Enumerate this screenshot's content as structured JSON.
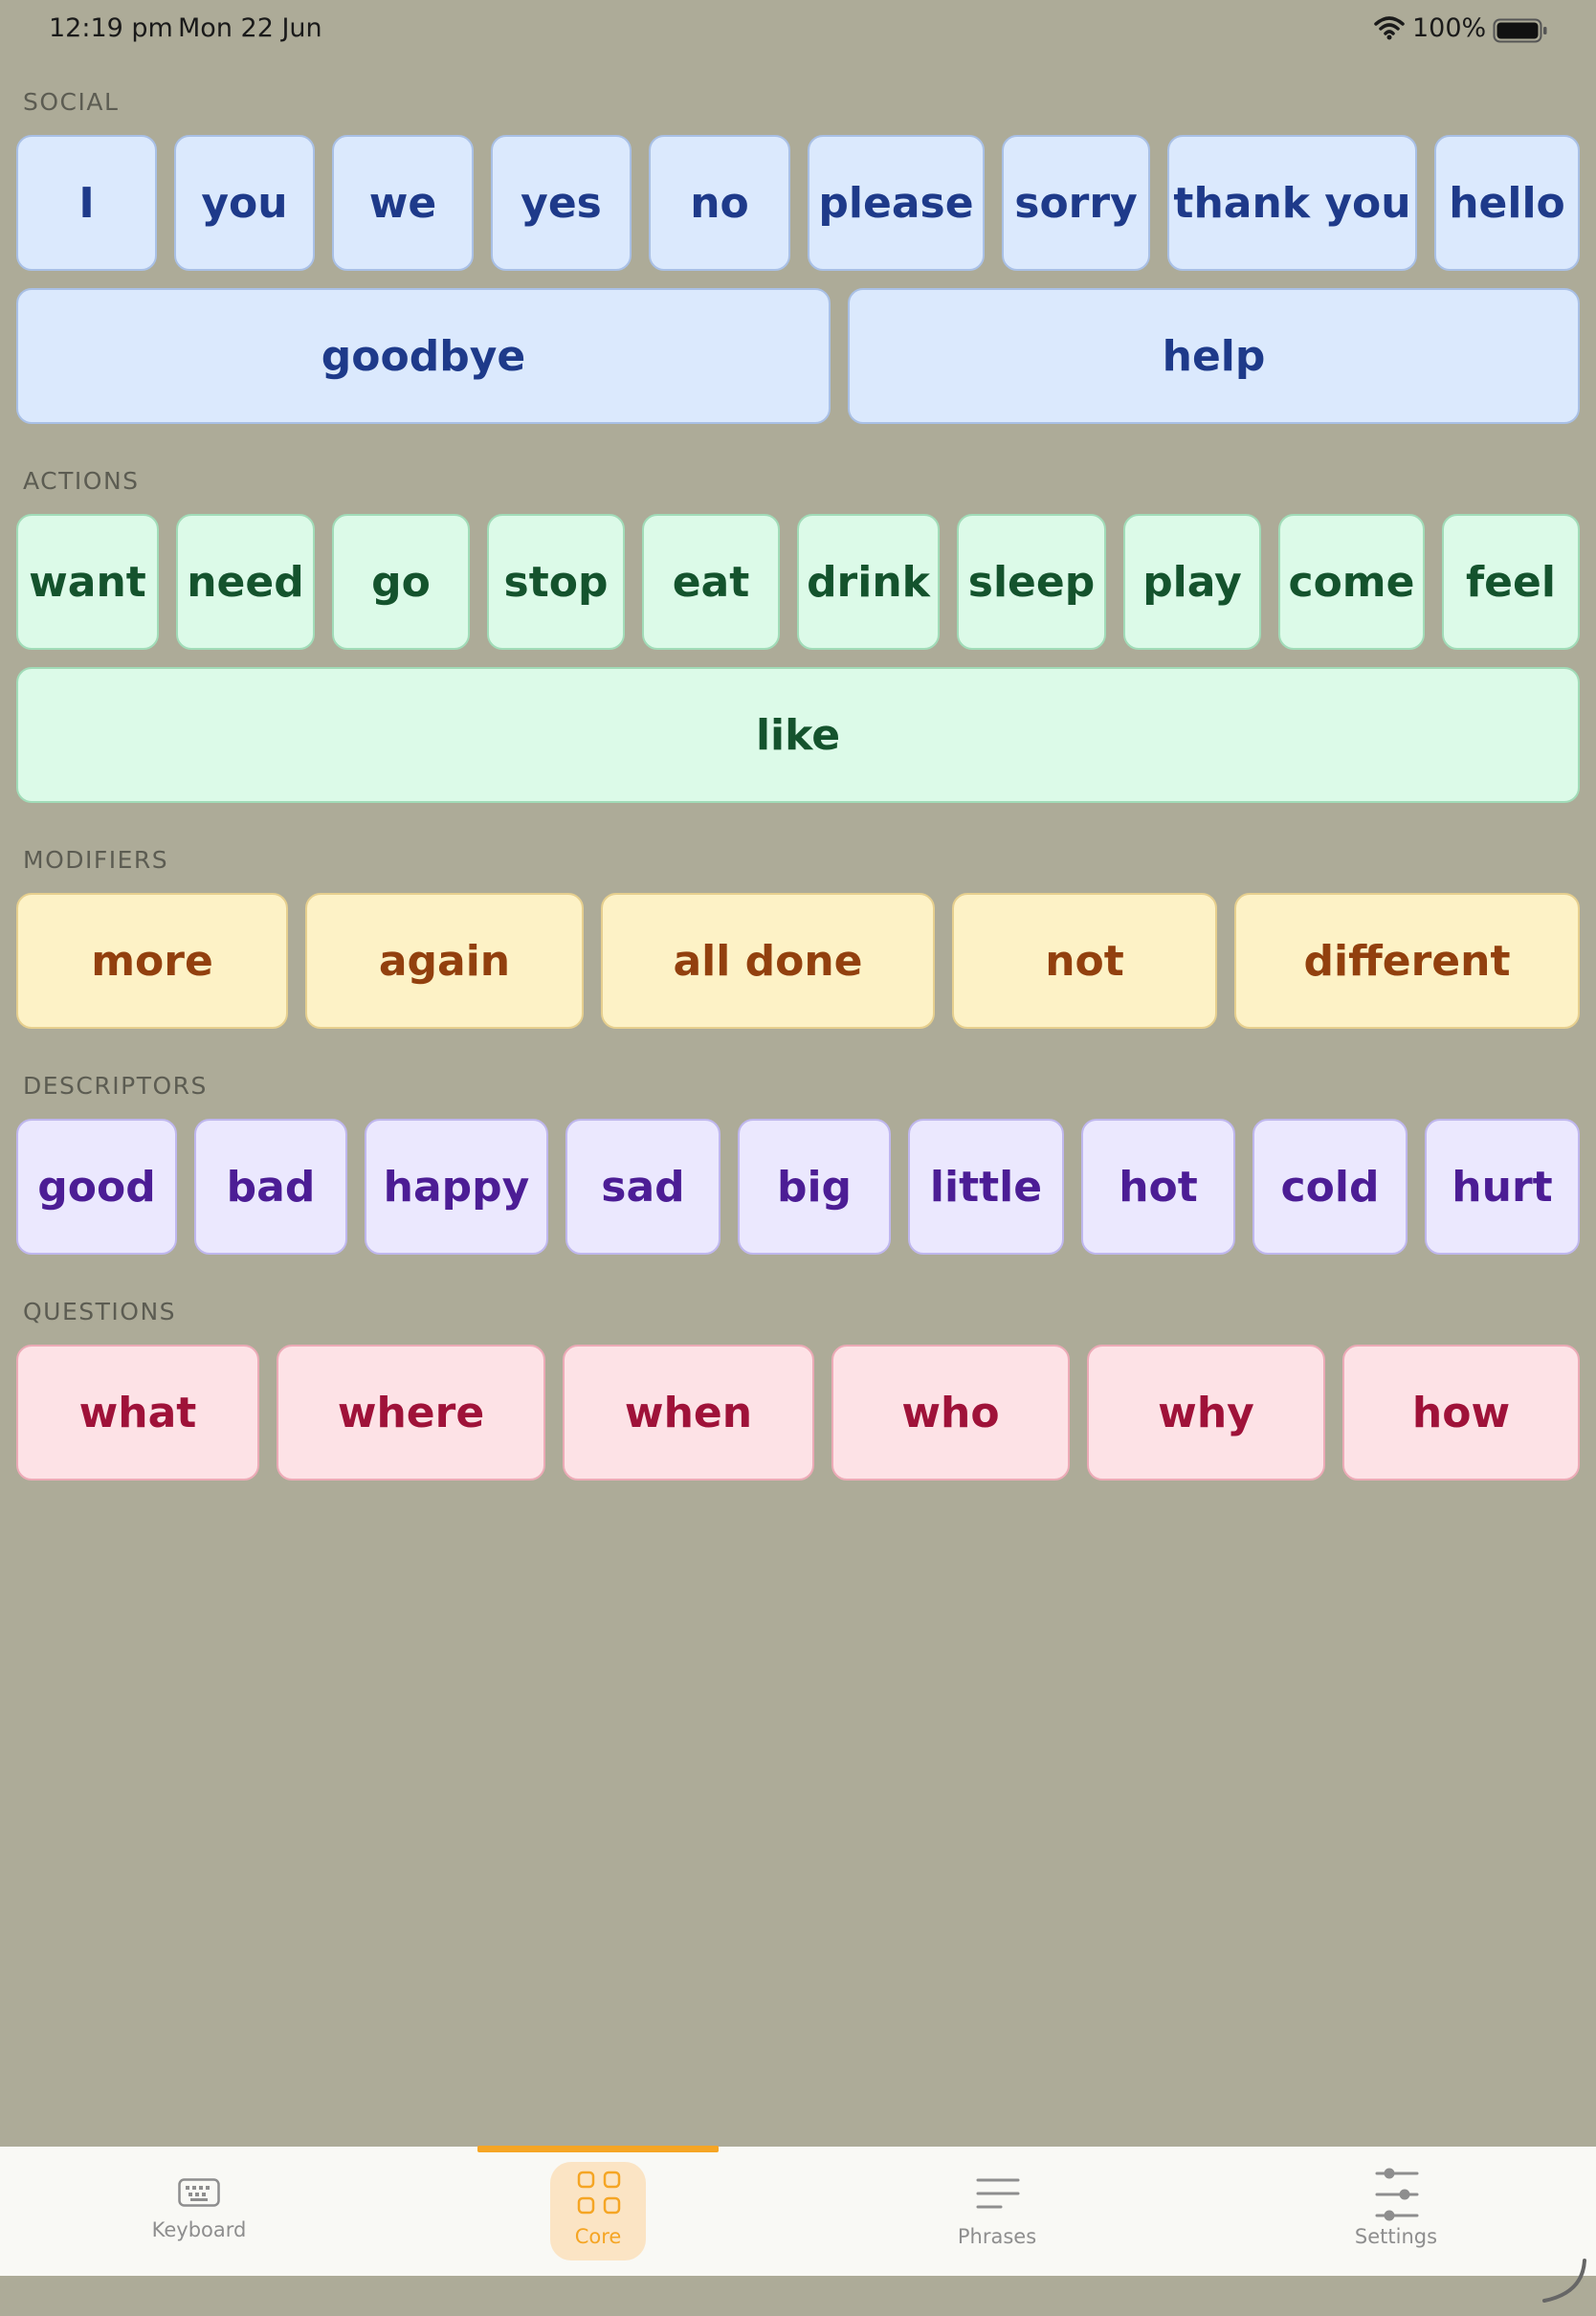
{
  "status": {
    "time": "12:19 pm",
    "date": "Mon 22 Jun",
    "battery": "100%"
  },
  "sections": {
    "social": {
      "label": "SOCIAL",
      "words": [
        "I",
        "you",
        "we",
        "yes",
        "no",
        "please",
        "sorry",
        "thank you",
        "hello",
        "goodbye",
        "help"
      ]
    },
    "actions": {
      "label": "ACTIONS",
      "words": [
        "want",
        "need",
        "go",
        "stop",
        "eat",
        "drink",
        "sleep",
        "play",
        "come",
        "feel",
        "like"
      ]
    },
    "modifiers": {
      "label": "MODIFIERS",
      "words": [
        "more",
        "again",
        "all done",
        "not",
        "different"
      ]
    },
    "descriptors": {
      "label": "DESCRIPTORS",
      "words": [
        "good",
        "bad",
        "happy",
        "sad",
        "big",
        "little",
        "hot",
        "cold",
        "hurt"
      ]
    },
    "questions": {
      "label": "QUESTIONS",
      "words": [
        "what",
        "where",
        "when",
        "who",
        "why",
        "how"
      ]
    }
  },
  "tabs": [
    {
      "label": "Keyboard",
      "icon": "keyboard-icon",
      "selected": false
    },
    {
      "label": "Core",
      "icon": "grid-icon",
      "selected": true
    },
    {
      "label": "Phrases",
      "icon": "lines-icon",
      "selected": false
    },
    {
      "label": "Settings",
      "icon": "sliders-icon",
      "selected": false
    }
  ],
  "colors": {
    "background": "#adab98",
    "accent": "#f5a524",
    "social": "#dbe9fd",
    "actions": "#dcfae8",
    "modifiers": "#fdf2c6",
    "descriptors": "#ebe8fe",
    "questions": "#fde2e6"
  }
}
